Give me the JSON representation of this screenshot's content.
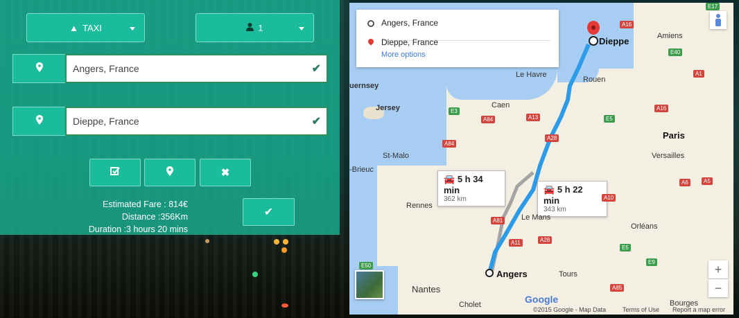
{
  "booking": {
    "vehicle": "TAXI",
    "passengers": "1",
    "origin": "Angers, France",
    "destination": "Dieppe, France"
  },
  "summary": {
    "fare": "Estimated Fare : 814€",
    "distance": "Distance :356Km",
    "duration": "Duration :3 hours 20 mins"
  },
  "map": {
    "directions": {
      "origin": "Angers, France",
      "destination": "Dieppe, France",
      "more_options": "More options"
    },
    "routes": [
      {
        "time": "5 h 34 min",
        "distance": "362 km"
      },
      {
        "time": "5 h 22 min",
        "distance": "343 km"
      }
    ],
    "cities": {
      "dieppe": "Dieppe",
      "amiens": "Amiens",
      "le_havre": "Le Havre",
      "rouen": "Rouen",
      "guernsey": "uernsey",
      "jersey": "Jersey",
      "caen": "Caen",
      "st_malo": "St-Malo",
      "brieuc": "-Brieuc",
      "rennes": "Rennes",
      "le_mans": "Le Mans",
      "paris": "Paris",
      "versailles": "Versailles",
      "orleans": "Orléans",
      "tours": "Tours",
      "angers": "Angers",
      "nantes": "Nantes",
      "cholet": "Cholet",
      "bourges": "Bourges"
    },
    "roads": {
      "e17": "E17",
      "a16": "A16",
      "e40": "E40",
      "a1": "A1",
      "e5": "E5",
      "a84": "A84",
      "e3": "E3",
      "a13": "A13",
      "a28": "A28",
      "a6": "A6",
      "a5": "A5",
      "a81": "A81",
      "a11": "A11",
      "e50": "E50",
      "a85": "A85",
      "e9": "E9",
      "a10": "A10",
      "a28b": "A28",
      "e5b": "E5",
      "e5c": "E5"
    },
    "footer": {
      "copyright": "©2015 Google - Map Data",
      "terms": "Terms of Use",
      "report": "Report a map error",
      "google": "Google"
    },
    "zoom_in": "+",
    "zoom_out": "−"
  }
}
